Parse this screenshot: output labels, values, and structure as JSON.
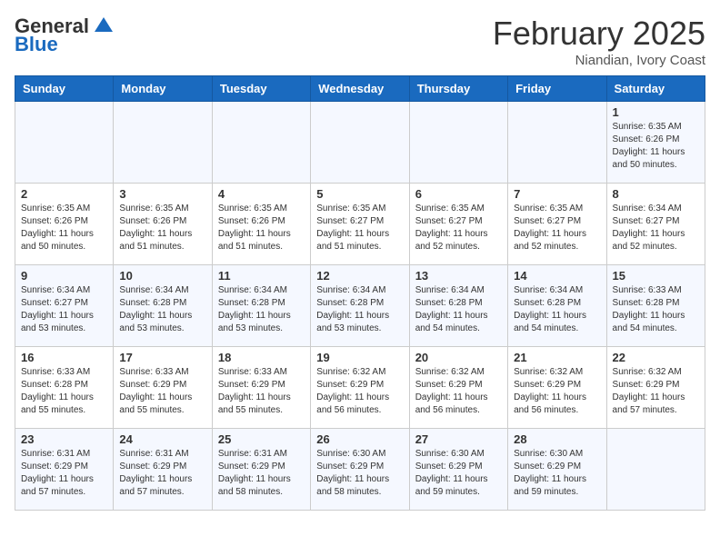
{
  "header": {
    "logo_general": "General",
    "logo_blue": "Blue",
    "month_title": "February 2025",
    "subtitle": "Niandian, Ivory Coast"
  },
  "weekdays": [
    "Sunday",
    "Monday",
    "Tuesday",
    "Wednesday",
    "Thursday",
    "Friday",
    "Saturday"
  ],
  "weeks": [
    [
      {
        "day": "",
        "info": ""
      },
      {
        "day": "",
        "info": ""
      },
      {
        "day": "",
        "info": ""
      },
      {
        "day": "",
        "info": ""
      },
      {
        "day": "",
        "info": ""
      },
      {
        "day": "",
        "info": ""
      },
      {
        "day": "1",
        "info": "Sunrise: 6:35 AM\nSunset: 6:26 PM\nDaylight: 11 hours\nand 50 minutes."
      }
    ],
    [
      {
        "day": "2",
        "info": "Sunrise: 6:35 AM\nSunset: 6:26 PM\nDaylight: 11 hours\nand 50 minutes."
      },
      {
        "day": "3",
        "info": "Sunrise: 6:35 AM\nSunset: 6:26 PM\nDaylight: 11 hours\nand 51 minutes."
      },
      {
        "day": "4",
        "info": "Sunrise: 6:35 AM\nSunset: 6:26 PM\nDaylight: 11 hours\nand 51 minutes."
      },
      {
        "day": "5",
        "info": "Sunrise: 6:35 AM\nSunset: 6:27 PM\nDaylight: 11 hours\nand 51 minutes."
      },
      {
        "day": "6",
        "info": "Sunrise: 6:35 AM\nSunset: 6:27 PM\nDaylight: 11 hours\nand 52 minutes."
      },
      {
        "day": "7",
        "info": "Sunrise: 6:35 AM\nSunset: 6:27 PM\nDaylight: 11 hours\nand 52 minutes."
      },
      {
        "day": "8",
        "info": "Sunrise: 6:34 AM\nSunset: 6:27 PM\nDaylight: 11 hours\nand 52 minutes."
      }
    ],
    [
      {
        "day": "9",
        "info": "Sunrise: 6:34 AM\nSunset: 6:27 PM\nDaylight: 11 hours\nand 53 minutes."
      },
      {
        "day": "10",
        "info": "Sunrise: 6:34 AM\nSunset: 6:28 PM\nDaylight: 11 hours\nand 53 minutes."
      },
      {
        "day": "11",
        "info": "Sunrise: 6:34 AM\nSunset: 6:28 PM\nDaylight: 11 hours\nand 53 minutes."
      },
      {
        "day": "12",
        "info": "Sunrise: 6:34 AM\nSunset: 6:28 PM\nDaylight: 11 hours\nand 53 minutes."
      },
      {
        "day": "13",
        "info": "Sunrise: 6:34 AM\nSunset: 6:28 PM\nDaylight: 11 hours\nand 54 minutes."
      },
      {
        "day": "14",
        "info": "Sunrise: 6:34 AM\nSunset: 6:28 PM\nDaylight: 11 hours\nand 54 minutes."
      },
      {
        "day": "15",
        "info": "Sunrise: 6:33 AM\nSunset: 6:28 PM\nDaylight: 11 hours\nand 54 minutes."
      }
    ],
    [
      {
        "day": "16",
        "info": "Sunrise: 6:33 AM\nSunset: 6:28 PM\nDaylight: 11 hours\nand 55 minutes."
      },
      {
        "day": "17",
        "info": "Sunrise: 6:33 AM\nSunset: 6:29 PM\nDaylight: 11 hours\nand 55 minutes."
      },
      {
        "day": "18",
        "info": "Sunrise: 6:33 AM\nSunset: 6:29 PM\nDaylight: 11 hours\nand 55 minutes."
      },
      {
        "day": "19",
        "info": "Sunrise: 6:32 AM\nSunset: 6:29 PM\nDaylight: 11 hours\nand 56 minutes."
      },
      {
        "day": "20",
        "info": "Sunrise: 6:32 AM\nSunset: 6:29 PM\nDaylight: 11 hours\nand 56 minutes."
      },
      {
        "day": "21",
        "info": "Sunrise: 6:32 AM\nSunset: 6:29 PM\nDaylight: 11 hours\nand 56 minutes."
      },
      {
        "day": "22",
        "info": "Sunrise: 6:32 AM\nSunset: 6:29 PM\nDaylight: 11 hours\nand 57 minutes."
      }
    ],
    [
      {
        "day": "23",
        "info": "Sunrise: 6:31 AM\nSunset: 6:29 PM\nDaylight: 11 hours\nand 57 minutes."
      },
      {
        "day": "24",
        "info": "Sunrise: 6:31 AM\nSunset: 6:29 PM\nDaylight: 11 hours\nand 57 minutes."
      },
      {
        "day": "25",
        "info": "Sunrise: 6:31 AM\nSunset: 6:29 PM\nDaylight: 11 hours\nand 58 minutes."
      },
      {
        "day": "26",
        "info": "Sunrise: 6:30 AM\nSunset: 6:29 PM\nDaylight: 11 hours\nand 58 minutes."
      },
      {
        "day": "27",
        "info": "Sunrise: 6:30 AM\nSunset: 6:29 PM\nDaylight: 11 hours\nand 59 minutes."
      },
      {
        "day": "28",
        "info": "Sunrise: 6:30 AM\nSunset: 6:29 PM\nDaylight: 11 hours\nand 59 minutes."
      },
      {
        "day": "",
        "info": ""
      }
    ]
  ]
}
